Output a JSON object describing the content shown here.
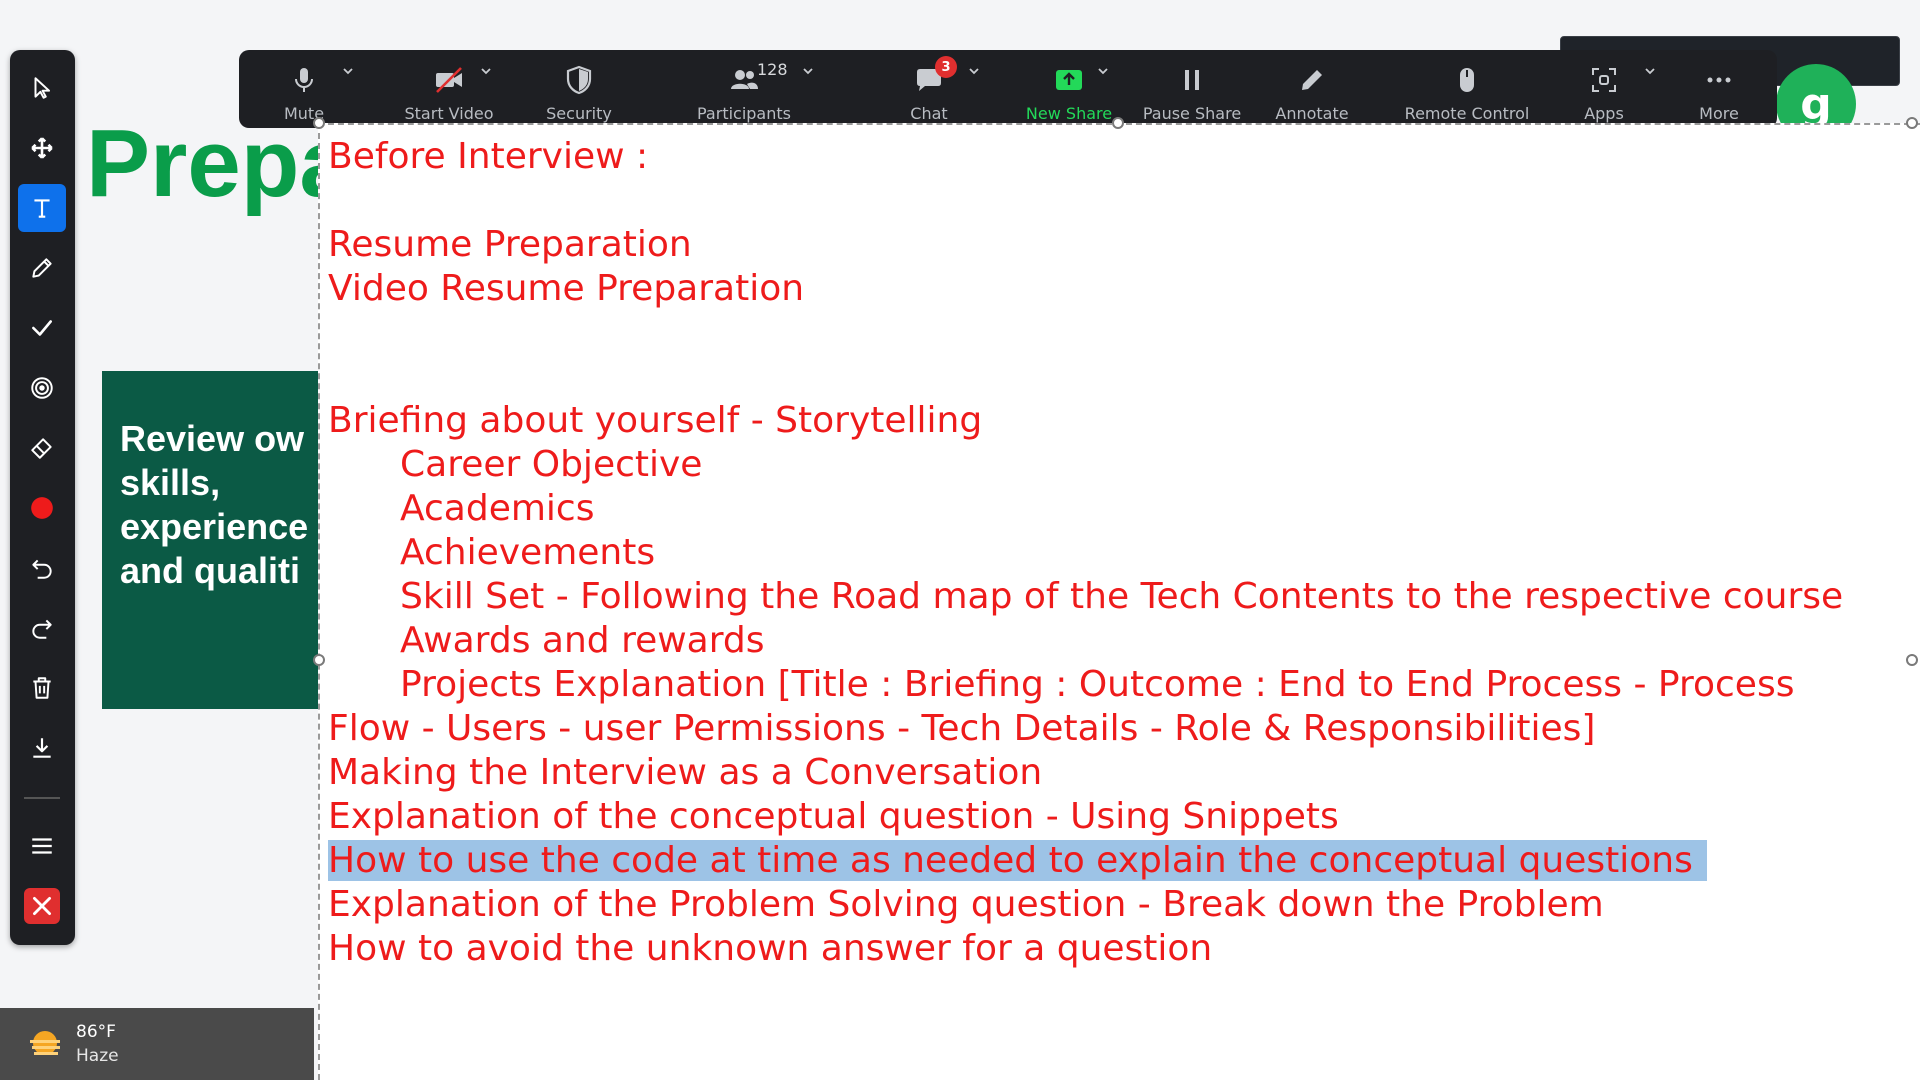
{
  "slide": {
    "title": "Prepa",
    "card_text": "Review ow\nskills,\nexperience\nand qualiti",
    "logo_letter": "g"
  },
  "taskbar": {
    "temperature": "86°F",
    "condition": "Haze"
  },
  "annotation_toolbar": {
    "tools": [
      {
        "name": "select-tool",
        "icon": "pointer-arrow-icon"
      },
      {
        "name": "move-tool",
        "icon": "move-arrows-icon"
      },
      {
        "name": "text-tool",
        "icon": "text-t-icon",
        "active": true
      },
      {
        "name": "draw-tool",
        "icon": "pencil-icon"
      },
      {
        "name": "stamp-tool",
        "icon": "checkmark-icon"
      },
      {
        "name": "spotlight-tool",
        "icon": "spotlight-icon"
      },
      {
        "name": "eraser-tool",
        "icon": "eraser-icon"
      },
      {
        "name": "color-tool",
        "icon": "red-dot-icon"
      },
      {
        "name": "undo-tool",
        "icon": "undo-icon"
      },
      {
        "name": "redo-tool",
        "icon": "redo-icon"
      },
      {
        "name": "clear-tool",
        "icon": "trash-icon"
      },
      {
        "name": "save-tool",
        "icon": "download-icon"
      },
      {
        "name": "menu-tool",
        "icon": "hamburger-menu-icon"
      },
      {
        "name": "close-tool",
        "icon": "close-x-icon"
      }
    ],
    "colors": {
      "active": "#0e71eb",
      "close": "#e02f2f",
      "pen": "#ee1b1b"
    }
  },
  "meeting_bar": {
    "mute": "Mute",
    "start_video": "Start Video",
    "security": "Security",
    "participants": "Participants",
    "participant_count": "128",
    "chat": "Chat",
    "chat_badge": "3",
    "new_share": "New Share",
    "pause_share": "Pause Share",
    "annotate": "Annotate",
    "remote_control": "Remote Control",
    "apps": "Apps",
    "more": "More"
  },
  "notes": {
    "lines": [
      {
        "text": "Before Interview :",
        "indent": false
      },
      {
        "text": "",
        "indent": false
      },
      {
        "text": "Resume Preparation",
        "indent": false
      },
      {
        "text": "Video Resume Preparation",
        "indent": false
      },
      {
        "text": "",
        "indent": false
      },
      {
        "text": "",
        "indent": false
      },
      {
        "text": "Briefing about yourself - Storytelling",
        "indent": false
      },
      {
        "text": "Career Objective",
        "indent": true
      },
      {
        "text": "Academics",
        "indent": true
      },
      {
        "text": "Achievements",
        "indent": true
      },
      {
        "text": "Skill Set - Following the Road map of the Tech Contents to the respective course",
        "indent": true
      },
      {
        "text": "Awards and rewards",
        "indent": true
      },
      {
        "text": "Projects Explanation [Title :  Briefing : Outcome : End to End Process - Process",
        "indent": true
      },
      {
        "text": "Flow - Users - user Permissions - Tech Details - Role & Responsibilities]",
        "indent": false
      },
      {
        "text": "Making the Interview as a Conversation",
        "indent": false
      },
      {
        "text": "Explanation of the conceptual question - Using Snippets",
        "indent": false
      },
      {
        "text": "How to use the code at time as needed to explain the conceptual questions",
        "indent": false,
        "highlight": true
      },
      {
        "text": "Explanation of the Problem Solving question - Break down the Problem",
        "indent": false
      },
      {
        "text": "How to avoid the unknown answer for a question",
        "indent": false
      }
    ]
  }
}
